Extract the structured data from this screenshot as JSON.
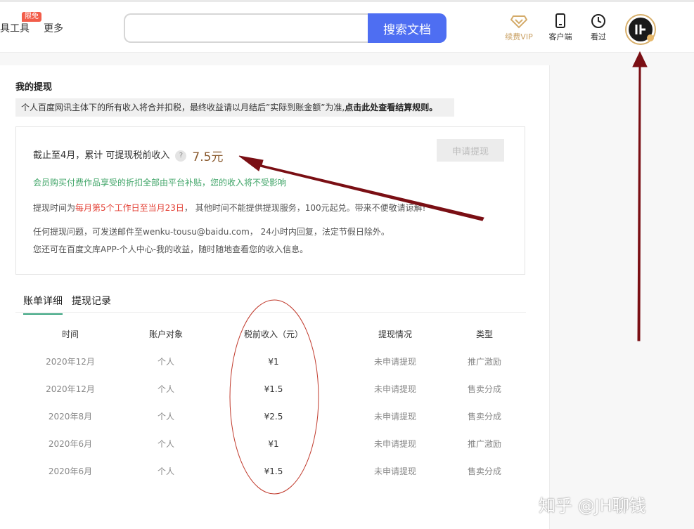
{
  "header": {
    "nav_tools": "具工具",
    "nav_badge": "限免",
    "nav_more": "更多",
    "search_placeholder": "",
    "search_button": "搜索文档",
    "vip_label": "续费VIP",
    "client_label": "客户端",
    "history_label": "看过"
  },
  "page": {
    "title": "我的提现",
    "notice_text": "个人百度网讯主体下的所有收入将合并扣税，最终收益请以月结后”实际到账金额”为准,",
    "notice_link": "点击此处查看结算规则。"
  },
  "summary": {
    "label": "截止至4月，累计 可提现税前收入",
    "help_icon": "?",
    "amount": "7.5元",
    "apply_button": "申请提现",
    "green_note": "会员购买付费作品享受的折扣全部由平台补贴，您的收入将不受影响",
    "info1_prefix": "提现时间为",
    "info1_red": "每月第5个工作日至当月23日",
    "info1_suffix": "， 其他时间不能提供提现服务，100元起兑。带来不便敬请谅解!",
    "info2": "任何提现问题，可发送邮件至wenku-tousu@baidu.com， 24小时内回复，法定节假日除外。",
    "info3": "您还可在百度文库APP-个人中心-我的收益，随时随地查看您的收入信息。"
  },
  "tabs": {
    "active": "账单详细",
    "other": "提现记录"
  },
  "table": {
    "headers": [
      "时间",
      "账户对象",
      "税前收入（元）",
      "提现情况",
      "类型"
    ],
    "rows": [
      [
        "2020年12月",
        "个人",
        "¥1",
        "未申请提现",
        "推广激励"
      ],
      [
        "2020年12月",
        "个人",
        "¥1.5",
        "未申请提现",
        "售卖分成"
      ],
      [
        "2020年8月",
        "个人",
        "¥2.5",
        "未申请提现",
        "售卖分成"
      ],
      [
        "2020年6月",
        "个人",
        "¥1",
        "未申请提现",
        "推广激励"
      ],
      [
        "2020年6月",
        "个人",
        "¥1.5",
        "未申请提现",
        "售卖分成"
      ]
    ]
  },
  "watermark": "知乎 @JH聊钱",
  "colors": {
    "accent_blue": "#4e6ef2",
    "tab_green": "#36a27d",
    "annotation_red": "#7a0f14",
    "vip_gold": "#c9a063"
  },
  "icons": [
    "diamond-vip-icon",
    "phone-icon",
    "clock-icon",
    "avatar-icon",
    "help-icon"
  ]
}
